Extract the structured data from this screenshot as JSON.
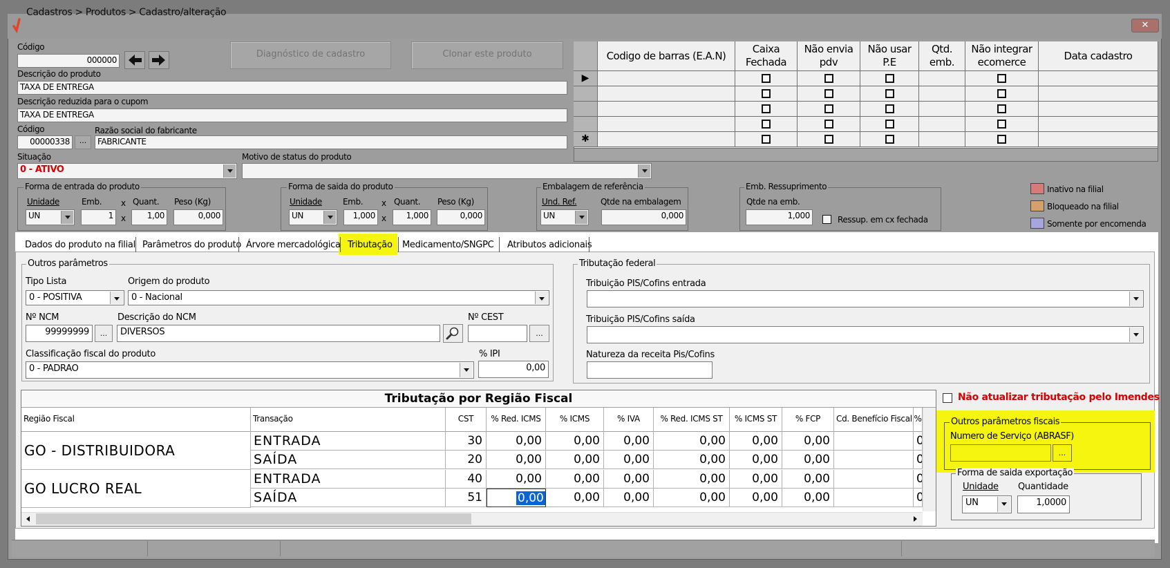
{
  "window": {
    "title": "Cadastros > Produtos > Cadastro/alteração",
    "close_symbol": "✕"
  },
  "codigo": {
    "label": "Código",
    "value": "000000"
  },
  "buttons": {
    "diagnostico": "Diagnóstico de cadastro",
    "clonar": "Clonar este produto"
  },
  "descricao": {
    "label": "Descrição  do produto",
    "value": "TAXA DE ENTREGA"
  },
  "descricao_reduzida": {
    "label": "Descrição reduzida para o cupom",
    "value": "TAXA DE ENTREGA"
  },
  "fabricante": {
    "codigo_label": "Código",
    "codigo_value": "00000338",
    "razao_label": "Razão social do fabricante",
    "razao_value": "FABRICANTE",
    "lookup_label": "..."
  },
  "situacao": {
    "label": "Situação",
    "value": "0 - ATIVO"
  },
  "motivo": {
    "label": "Motivo de status do produto",
    "value": ""
  },
  "barcode_grid": {
    "columns": [
      "Codigo de barras (E.A.N)",
      "Caixa Fechada",
      "Não envia pdv",
      "Não usar P.E",
      "Qtd. emb.",
      "Não integrar ecomerce",
      "Data cadastro"
    ],
    "current_row_marker": "▶",
    "new_row_marker": "✱"
  },
  "entrada": {
    "legend": "Forma de entrada do produto",
    "unidade_label": "Unidade",
    "unidade": "UN",
    "emb_label": "Emb.",
    "emb": "1",
    "quant_label": "Quant.",
    "quant": "1,00",
    "peso_label": "Peso (Kg)",
    "peso": "0,000",
    "x": "x"
  },
  "saida": {
    "legend": "Forma de saida do produto",
    "unidade_label": "Unidade",
    "unidade": "UN",
    "emb_label": "Emb.",
    "emb": "1,000",
    "quant_label": "Quant.",
    "quant": "1,000",
    "peso_label": "Peso (Kg)",
    "peso": "0,000"
  },
  "embalagem_ref": {
    "legend": "Embalagem de referência",
    "und_label": "Und. Ref.",
    "und": "UN",
    "qtde_label": "Qtde na embalagem",
    "qtde": "0,000"
  },
  "emb_ressup": {
    "legend": "Emb. Ressuprimento",
    "qtde_label": "Qtde na emb.",
    "qtde": "1,000",
    "check_label": "Ressup. em cx fechada"
  },
  "legend_colors": [
    {
      "label": "Inativo na filial",
      "color": "#d97a7a"
    },
    {
      "label": "Bloqueado na filial",
      "color": "#d6a06a"
    },
    {
      "label": "Somente por encomenda",
      "color": "#a6a6de"
    }
  ],
  "tabs": [
    "Dados do produto na filial",
    "Parâmetros do produto",
    "Árvore mercadológica",
    "Tributação",
    "Medicamento/SNGPC",
    "Atributos adicionais"
  ],
  "outros_parametros": {
    "legend": "Outros parâmetros",
    "tipo_lista_label": "Tipo Lista",
    "tipo_lista": "0 - POSITIVA",
    "origem_label": "Origem do produto",
    "origem": "0 - Nacional",
    "ncm_label": "Nº NCM",
    "ncm": "99999999",
    "desc_ncm_label": "Descrição do NCM",
    "desc_ncm": "DIVERSOS",
    "cest_label": "Nº CEST",
    "cest": "",
    "classificacao_label": "Classificação fiscal do produto",
    "classificacao": "0 - PADRAO",
    "ipi_label": "% IPI",
    "ipi": "0,00"
  },
  "tributacao_federal": {
    "legend": "Tributação federal",
    "pis_entrada_label": "Tribuição PIS/Cofins entrada",
    "pis_entrada": "",
    "pis_saida_label": "Tribuição PIS/Cofins saída",
    "pis_saida": "",
    "natureza_label": "Natureza da receita Pis/Cofins",
    "natureza": ""
  },
  "regiao_table": {
    "title": "Tributação por Região Fiscal",
    "headers": [
      "Região Fiscal",
      "Transação",
      "CST",
      "% Red. ICMS",
      "% ICMS",
      "% IVA",
      "% Red. ICMS ST",
      "% ICMS ST",
      "% FCP",
      "Cd. Benefício Fiscal",
      "%"
    ],
    "regions": [
      {
        "name": "GO - DISTRIBUIDORA",
        "rows": [
          {
            "transacao": "ENTRADA",
            "cst": "30",
            "red_icms": "0,00",
            "icms": "0,00",
            "iva": "0,00",
            "red_icms_st": "0,00",
            "icms_st": "0,00",
            "fcp": "0,00",
            "beneficio": "",
            "extra": "0"
          },
          {
            "transacao": "SAÍDA",
            "cst": "20",
            "red_icms": "0,00",
            "icms": "0,00",
            "iva": "0,00",
            "red_icms_st": "0,00",
            "icms_st": "0,00",
            "fcp": "0,00",
            "beneficio": "",
            "extra": "0"
          }
        ]
      },
      {
        "name": "GO LUCRO REAL",
        "rows": [
          {
            "transacao": "ENTRADA",
            "cst": "40",
            "red_icms": "0,00",
            "icms": "0,00",
            "iva": "0,00",
            "red_icms_st": "0,00",
            "icms_st": "0,00",
            "fcp": "0,00",
            "beneficio": "",
            "extra": "0"
          },
          {
            "transacao": "SAÍDA",
            "cst": "51",
            "red_icms": "0,00",
            "icms": "0,00",
            "iva": "0,00",
            "red_icms_st": "0,00",
            "icms_st": "0,00",
            "fcp": "0,00",
            "beneficio": "",
            "extra": "0"
          }
        ]
      }
    ]
  },
  "nao_atualizar": "Não atualizar tributação pelo Imendes",
  "outros_fiscais": {
    "legend": "Outros parâmetros fiscais",
    "servico_label": "Numero de Serviço (ABRASF)",
    "servico": ""
  },
  "exportacao": {
    "legend": "Forma de saida exportação",
    "unidade_label": "Unidade",
    "unidade": "UN",
    "quantidade_label": "Quantidade",
    "quantidade": "1,0000"
  },
  "colors": {
    "highlight": "#f5f50f",
    "inactive_red": "#d80000",
    "selection": "#0a64d6"
  }
}
